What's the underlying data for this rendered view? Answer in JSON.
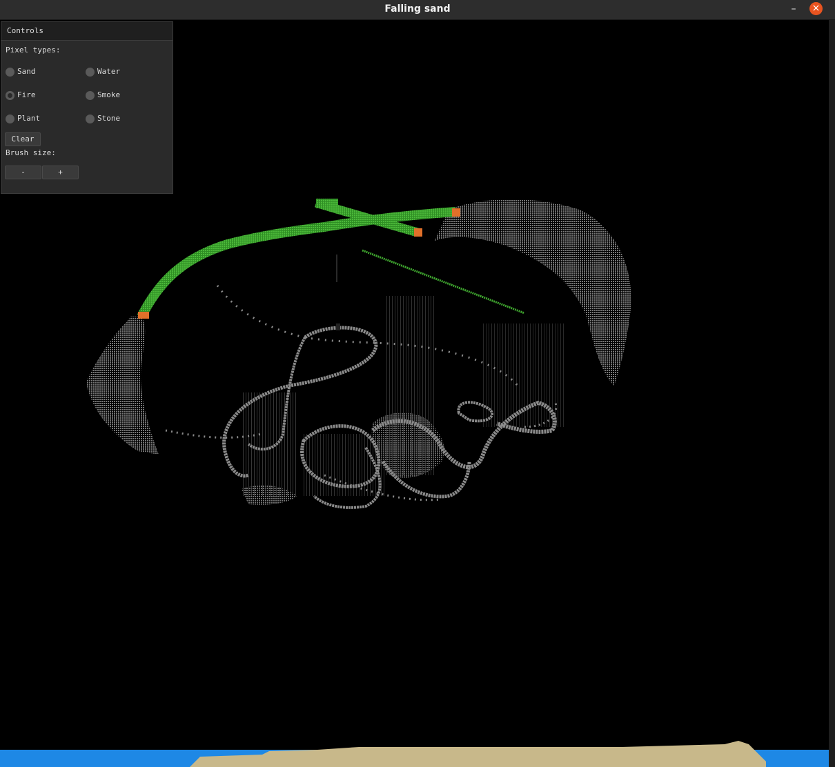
{
  "window": {
    "title": "Falling sand",
    "minimize_glyph": "–",
    "close_glyph": "×"
  },
  "controls": {
    "header": "Controls",
    "pixel_types_label": "Pixel types:",
    "pixel_types": [
      {
        "label": "Sand",
        "selected": false
      },
      {
        "label": "Water",
        "selected": false
      },
      {
        "label": "Fire",
        "selected": true
      },
      {
        "label": "Smoke",
        "selected": false
      },
      {
        "label": "Plant",
        "selected": false
      },
      {
        "label": "Stone",
        "selected": false
      }
    ],
    "clear_label": "Clear",
    "brush_size_label": "Brush size:",
    "decrease_label": "-",
    "increase_label": "+"
  },
  "colors": {
    "sand": "#c8b88a",
    "water": "#1e88e5",
    "plant": "#3fa52f",
    "fire": "#e0702a",
    "stone": "#808080",
    "accent_close": "#e95420"
  },
  "icons": {
    "minimize": "minimize-icon",
    "close": "close-icon"
  }
}
